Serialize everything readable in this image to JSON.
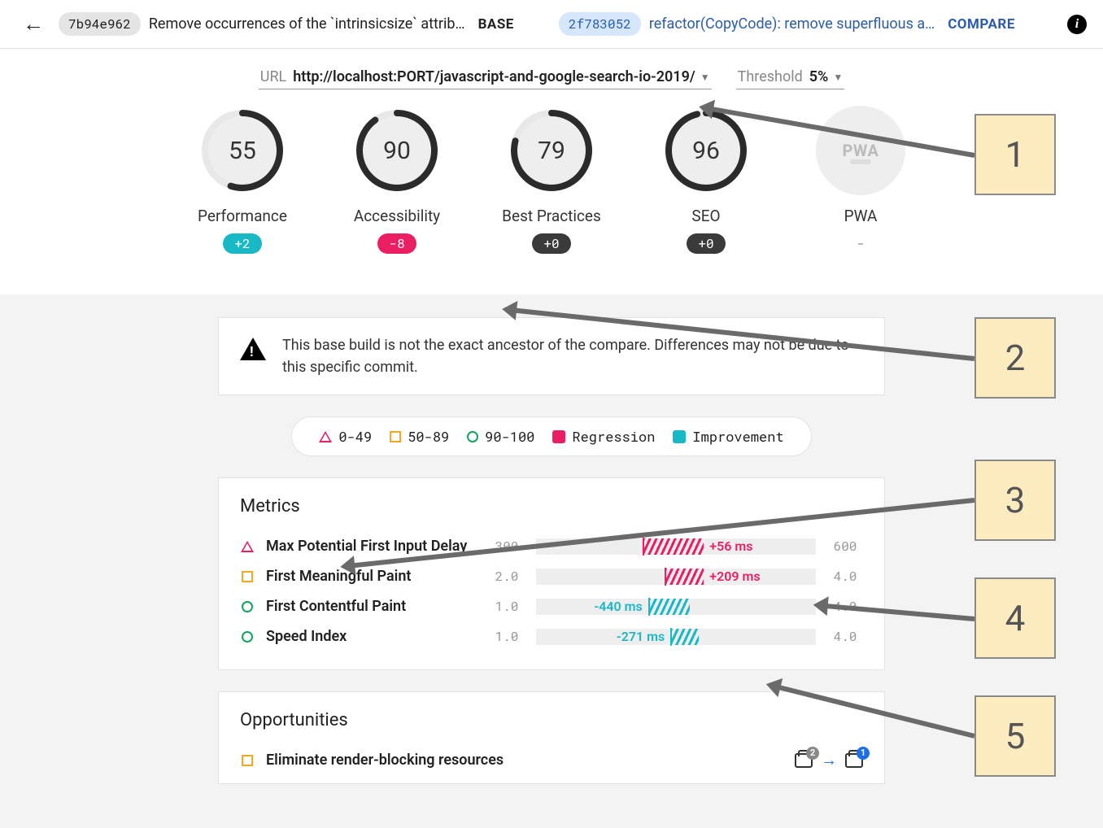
{
  "header": {
    "base": {
      "hash": "7b94e962",
      "msg": "Remove occurrences of the `intrinsicsize` attrib…",
      "tag": "BASE"
    },
    "compare": {
      "hash": "2f783052",
      "msg": "refactor(CopyCode): remove superfluous a…",
      "tag": "COMPARE"
    }
  },
  "url_row": {
    "url_label": "URL",
    "url_value": "http://localhost:PORT/javascript-and-google-search-io-2019/",
    "thresh_label": "Threshold",
    "thresh_value": "5%"
  },
  "gauges": [
    {
      "score": "55",
      "label": "Performance",
      "delta": "+2",
      "pill": "pill-teal",
      "pct": 55
    },
    {
      "score": "90",
      "label": "Accessibility",
      "delta": "-8",
      "pill": "pill-pink",
      "pct": 90
    },
    {
      "score": "79",
      "label": "Best Practices",
      "delta": "+0",
      "pill": "pill-dark",
      "pct": 79
    },
    {
      "score": "96",
      "label": "SEO",
      "delta": "+0",
      "pill": "pill-dark",
      "pct": 96
    },
    {
      "score": "PWA",
      "label": "PWA",
      "delta": "-",
      "pill": "pill-none",
      "pct": 0
    }
  ],
  "warning": "This base build is not the exact ancestor of the compare. Differences may not be due to this specific commit.",
  "legend": {
    "r0": "0-49",
    "r1": "50-89",
    "r2": "90-100",
    "reg": "Regression",
    "imp": "Improvement"
  },
  "metrics_title": "Metrics",
  "metrics": [
    {
      "icon": "tri",
      "name": "Max Potential First Input Delay",
      "min": "300",
      "max": "600",
      "delta": "+56 ms",
      "cls": "pink",
      "seg_l": 38,
      "seg_w": 22,
      "lab_side": "right"
    },
    {
      "icon": "sq",
      "name": "First Meaningful Paint",
      "min": "2.0",
      "max": "4.0",
      "delta": "+209 ms",
      "cls": "pink",
      "seg_l": 46,
      "seg_w": 14,
      "lab_side": "right"
    },
    {
      "icon": "cir",
      "name": "First Contentful Paint",
      "min": "1.0",
      "max": "4.0",
      "delta": "-440 ms",
      "cls": "teal",
      "seg_l": 40,
      "seg_w": 15,
      "lab_side": "left"
    },
    {
      "icon": "cir",
      "name": "Speed Index",
      "min": "1.0",
      "max": "4.0",
      "delta": "-271 ms",
      "cls": "teal",
      "seg_l": 48,
      "seg_w": 10,
      "lab_side": "left"
    }
  ],
  "opps_title": "Opportunities",
  "opps": [
    {
      "icon": "sq",
      "name": "Eliminate render-blocking resources",
      "badge_l": "2",
      "badge_r": "1"
    }
  ],
  "callouts": [
    "1",
    "2",
    "3",
    "4",
    "5"
  ]
}
